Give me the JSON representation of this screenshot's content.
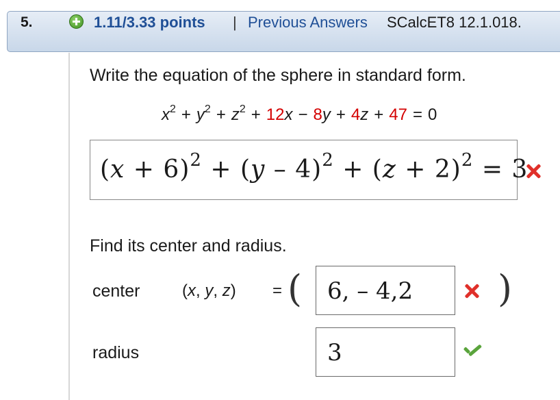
{
  "header": {
    "number": "5.",
    "points": "1.11/3.33 points",
    "separator": "|",
    "previous_answers": "Previous Answers",
    "source": "SCalcET8 12.1.018."
  },
  "part1": {
    "prompt": "Write the equation of the sphere in standard form.",
    "given": {
      "t1_var": "x",
      "t1_exp": "2",
      "op1": "+",
      "t2_var": "y",
      "t2_exp": "2",
      "op2": "+",
      "t3_var": "z",
      "t3_exp": "2",
      "op3": "+",
      "c_x": "12",
      "v_x": "x",
      "op4": "−",
      "c_y": "8",
      "v_y": "y",
      "op5": "+",
      "c_z": "4",
      "v_z": "z",
      "op6": "+",
      "c_0": "47",
      "eq": "=",
      "rhs": "0"
    },
    "answer": {
      "a1": "(",
      "x": "x",
      "a2": " + 6)",
      "e1": "2",
      "p1": " + (",
      "y": "y",
      "a3": " – 4)",
      "e2": "2",
      "p2": " + (",
      "z": "z",
      "a4": " + 2)",
      "e3": "2",
      "eq": " = 3"
    },
    "status": "incorrect"
  },
  "part2": {
    "prompt": "Find its center and radius.",
    "center": {
      "label": "center",
      "tuple_open": "(",
      "x": "x",
      "c1": ", ",
      "y": "y",
      "c2": ", ",
      "z": "z",
      "tuple_close": ")",
      "equals": "=",
      "open_paren": "(",
      "value": "6, – 4,2",
      "close_paren": ")",
      "status": "incorrect"
    },
    "radius": {
      "label": "radius",
      "value": "3",
      "status": "correct"
    }
  },
  "colors": {
    "link": "#1f4f96",
    "coefficient": "#d40000",
    "incorrect": "#e0302a",
    "correct": "#5aa43c"
  }
}
